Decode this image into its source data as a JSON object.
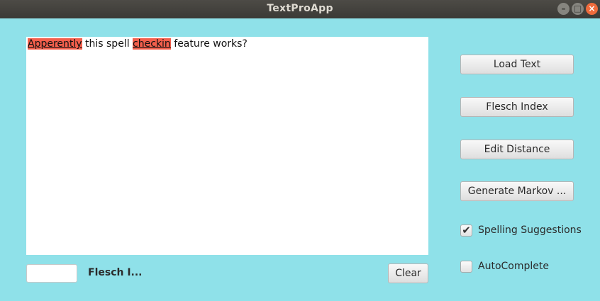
{
  "window": {
    "title": "TextProApp",
    "controls": {
      "minimize": "–",
      "maximize": "□",
      "close": "×"
    }
  },
  "editor": {
    "segments": [
      {
        "text": "Apperently",
        "misspelled": true
      },
      {
        "text": " this spell ",
        "misspelled": false
      },
      {
        "text": "checkin",
        "misspelled": true
      },
      {
        "text": " feature works?",
        "misspelled": false
      }
    ],
    "misspelled_highlight_color": "#f35f4c",
    "background_color": "#ffffff"
  },
  "bottom_bar": {
    "flesch_score_value": "",
    "flesch_label": "Flesch I...",
    "clear_label": "Clear"
  },
  "sidebar": {
    "load_text_label": "Load Text",
    "flesch_index_label": "Flesch Index",
    "edit_distance_label": "Edit Distance",
    "generate_markov_label": "Generate Markov ...",
    "spelling_suggestions": {
      "label": "Spelling Suggestions",
      "checked": true
    },
    "autocomplete": {
      "label": "AutoComplete",
      "checked": false
    }
  },
  "colors": {
    "window_background": "#8fe1e9",
    "titlebar": "#3b3a36"
  }
}
